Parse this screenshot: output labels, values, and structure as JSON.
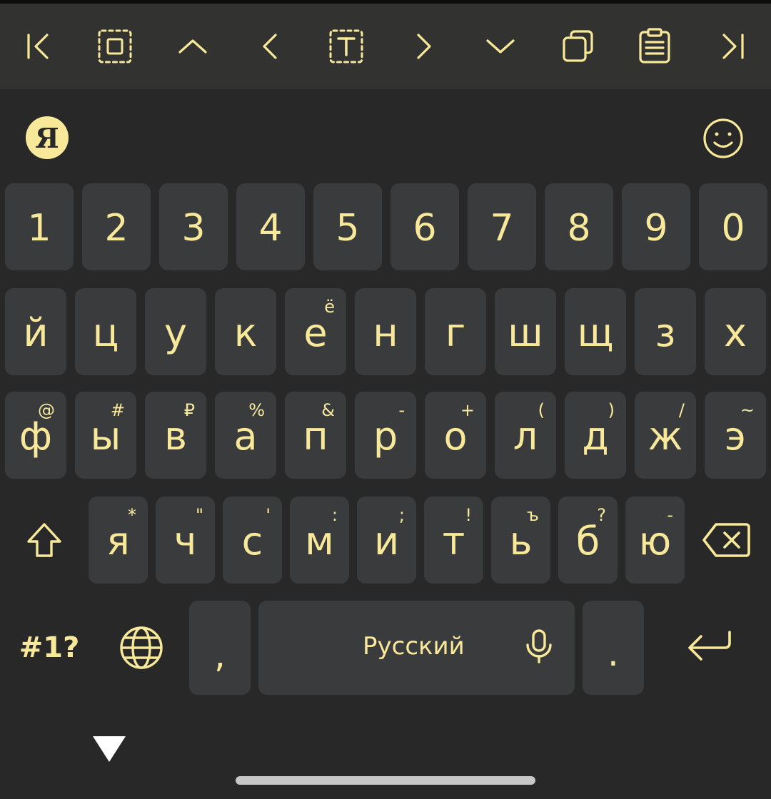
{
  "toolbar": {
    "items": [
      {
        "icon": "cursor-start-icon"
      },
      {
        "icon": "select-all-icon"
      },
      {
        "icon": "cursor-up-icon"
      },
      {
        "icon": "cursor-left-icon"
      },
      {
        "icon": "select-text-icon"
      },
      {
        "icon": "cursor-right-icon"
      },
      {
        "icon": "cursor-down-icon"
      },
      {
        "icon": "copy-icon"
      },
      {
        "icon": "clipboard-icon"
      },
      {
        "icon": "cursor-end-icon"
      }
    ]
  },
  "suggestions": {
    "logo_text": "Я",
    "emoji_icon": "emoji-icon"
  },
  "rows": {
    "numbers": [
      "1",
      "2",
      "3",
      "4",
      "5",
      "6",
      "7",
      "8",
      "9",
      "0"
    ],
    "row1": [
      {
        "main": "й",
        "hint": ""
      },
      {
        "main": "ц",
        "hint": ""
      },
      {
        "main": "у",
        "hint": ""
      },
      {
        "main": "к",
        "hint": ""
      },
      {
        "main": "е",
        "hint": "ё"
      },
      {
        "main": "н",
        "hint": ""
      },
      {
        "main": "г",
        "hint": ""
      },
      {
        "main": "ш",
        "hint": ""
      },
      {
        "main": "щ",
        "hint": ""
      },
      {
        "main": "з",
        "hint": ""
      },
      {
        "main": "х",
        "hint": ""
      }
    ],
    "row2": [
      {
        "main": "ф",
        "hint": "@"
      },
      {
        "main": "ы",
        "hint": "#"
      },
      {
        "main": "в",
        "hint": "₽"
      },
      {
        "main": "а",
        "hint": "%"
      },
      {
        "main": "п",
        "hint": "&"
      },
      {
        "main": "р",
        "hint": "-"
      },
      {
        "main": "о",
        "hint": "+"
      },
      {
        "main": "л",
        "hint": "("
      },
      {
        "main": "д",
        "hint": ")"
      },
      {
        "main": "ж",
        "hint": "/"
      },
      {
        "main": "э",
        "hint": "~"
      }
    ],
    "row3": [
      {
        "main": "я",
        "hint": "*"
      },
      {
        "main": "ч",
        "hint": "\""
      },
      {
        "main": "с",
        "hint": "'"
      },
      {
        "main": "м",
        "hint": ":"
      },
      {
        "main": "и",
        "hint": ";"
      },
      {
        "main": "т",
        "hint": "!"
      },
      {
        "main": "ь",
        "hint": "ъ"
      },
      {
        "main": "б",
        "hint": "?"
      },
      {
        "main": "ю",
        "hint": "-"
      }
    ]
  },
  "bottom": {
    "symbols_label": "#1?",
    "comma_label": ",",
    "space_label": "Русский",
    "period_label": "."
  },
  "colors": {
    "accent": "#f8e99a",
    "background": "#282828",
    "key": "#3a3b3d",
    "toolbar": "#323230"
  }
}
